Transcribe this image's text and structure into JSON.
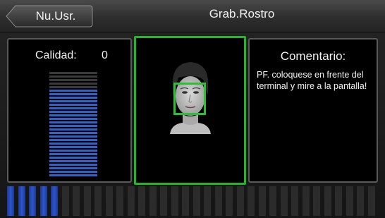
{
  "header": {
    "back_label": "Nu.Usr.",
    "title": "Grab.Rostro"
  },
  "quality": {
    "label": "Calidad:",
    "value": "0",
    "level_fraction": 0.0
  },
  "comment": {
    "title": "Comentario:",
    "text": "PF. coloquese en frente del terminal y mire a la pantalla!"
  },
  "progress": {
    "segments_total": 34,
    "segments_done": 5
  },
  "colors": {
    "accent_green": "#23b52b",
    "meter_blue": "#2e63c8",
    "segment_done": "#2f55c8",
    "segment_todo": "#2b2b2b"
  },
  "icons": {
    "back": "chevron-left-icon",
    "face": "face-preview-icon"
  }
}
